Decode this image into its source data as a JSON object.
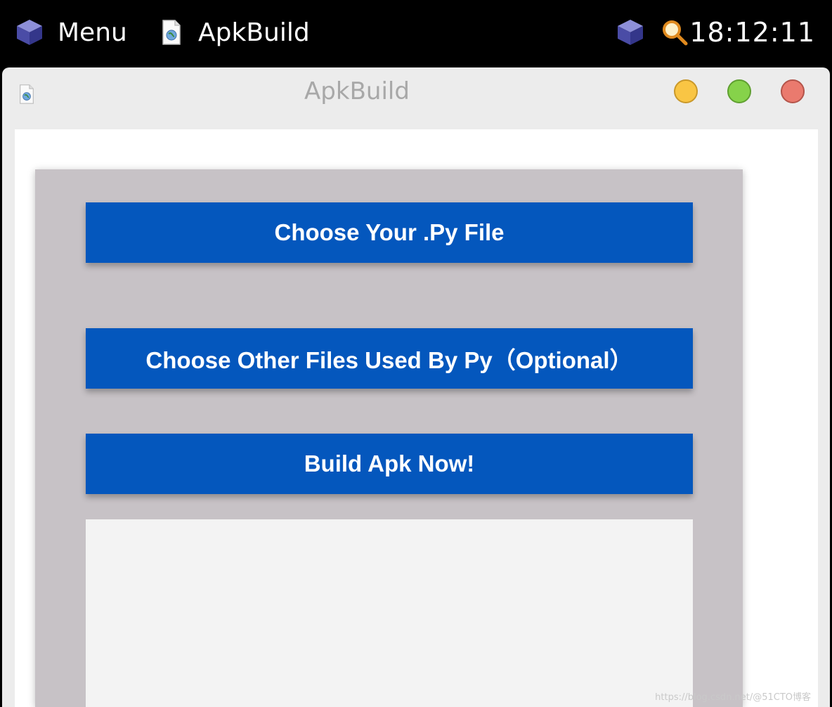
{
  "topbar": {
    "menu_label": "Menu",
    "app_label": "ApkBuild",
    "clock": "18:12:11"
  },
  "window": {
    "title": "ApkBuild"
  },
  "buttons": {
    "choose_py": "Choose Your .Py File",
    "choose_other": "Choose Other Files Used By Py（Optional）",
    "build": "Build Apk Now!"
  },
  "output": {
    "text": ""
  },
  "watermark": "https://blog.csdn.net/@51CTO博客",
  "colors": {
    "button_bg": "#0457bd",
    "panel_bg": "#c7c2c6",
    "output_bg": "#f3f3f3",
    "minimize": "#f9c544",
    "maximize": "#86d24a",
    "close": "#ea7a6e"
  },
  "icons": {
    "menu": "cube-icon",
    "app": "document-globe-icon",
    "tray_cube": "cube-icon",
    "tray_search": "magnifier-icon",
    "window": "document-globe-icon"
  }
}
